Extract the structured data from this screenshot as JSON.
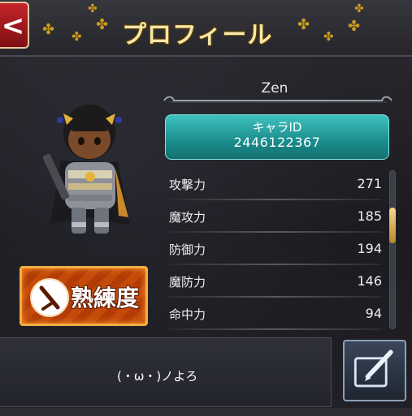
{
  "header": {
    "title": "プロフィール",
    "back_icon": "back-chevron-icon",
    "ornament_color": "#c99a1e"
  },
  "profile": {
    "name": "Zen",
    "id_label": "キャラID",
    "id_value": "2446122367",
    "id_box_color": "#2aa6a4"
  },
  "mastery": {
    "label": "熟練度",
    "icon": "sword-icon",
    "color": "#c44a0a"
  },
  "stats": [
    {
      "label": "攻撃力",
      "value": "271"
    },
    {
      "label": "魔攻力",
      "value": "185"
    },
    {
      "label": "防御力",
      "value": "194"
    },
    {
      "label": "魔防力",
      "value": "146"
    },
    {
      "label": "命中力",
      "value": "94"
    }
  ],
  "scroll": {
    "position": 0.3
  },
  "comment": {
    "text": "(・ω・)ノよろ",
    "edit_icon": "edit-pencil-icon"
  }
}
